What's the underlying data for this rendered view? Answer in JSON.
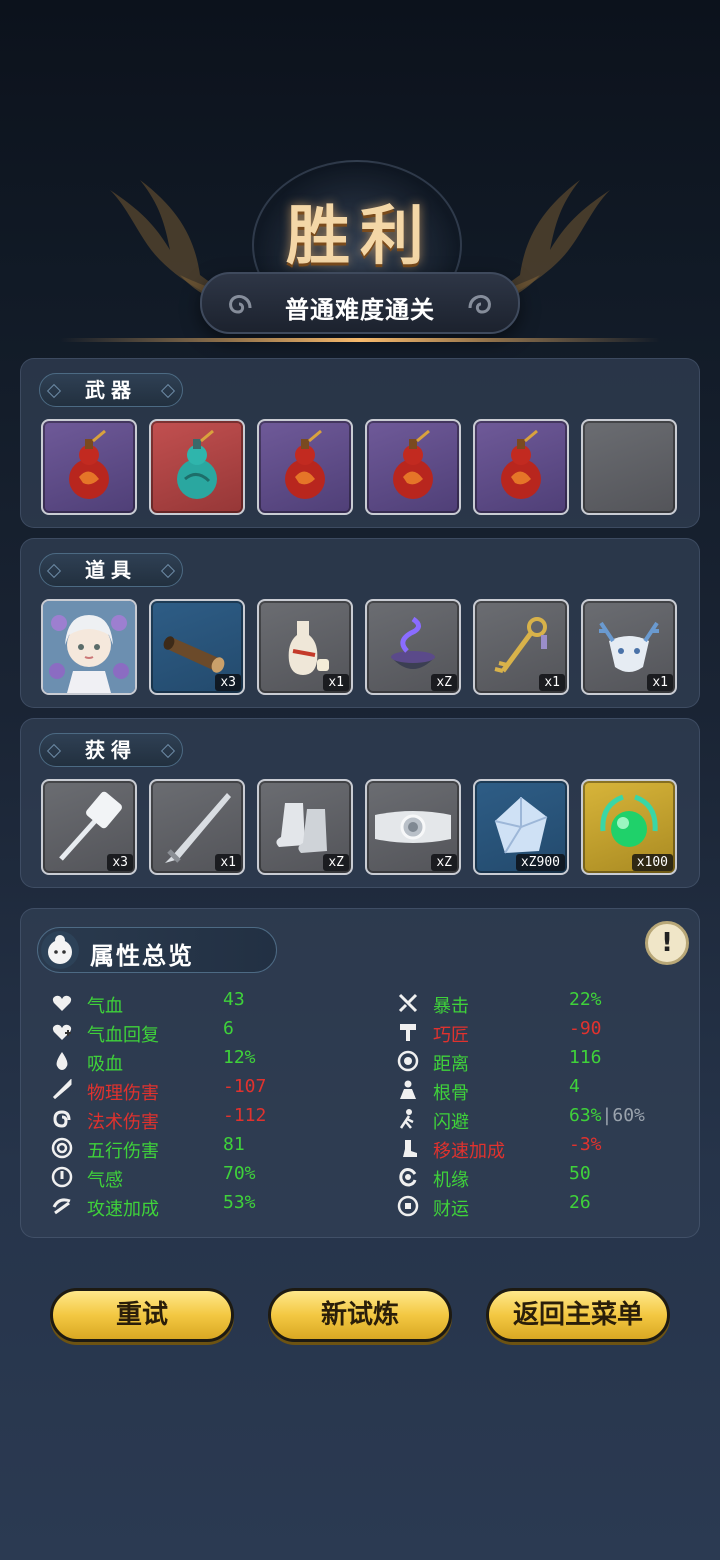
{
  "header": {
    "title": "胜利",
    "subtitle": "普通难度通关"
  },
  "weapons": {
    "label": "武器",
    "slots": [
      {
        "rarity": "purple",
        "icon": "red-gourd-icon"
      },
      {
        "rarity": "red",
        "icon": "teal-gourd-icon"
      },
      {
        "rarity": "purple",
        "icon": "red-gourd-icon"
      },
      {
        "rarity": "purple",
        "icon": "red-gourd-icon"
      },
      {
        "rarity": "purple",
        "icon": "red-gourd-icon"
      },
      {
        "rarity": "gray",
        "icon": "empty-slot"
      }
    ]
  },
  "items": {
    "label": "道具",
    "slots": [
      {
        "rarity": "purple",
        "icon": "character-portrait",
        "count": ""
      },
      {
        "rarity": "blue",
        "icon": "wood-log-icon",
        "count": "x3"
      },
      {
        "rarity": "gray",
        "icon": "wine-bottle-icon",
        "count": "x1"
      },
      {
        "rarity": "gray",
        "icon": "incense-bowl-icon",
        "count": "xZ"
      },
      {
        "rarity": "gray",
        "icon": "golden-key-icon",
        "count": "x1"
      },
      {
        "rarity": "gray",
        "icon": "deer-mask-icon",
        "count": "x1"
      }
    ]
  },
  "obtained": {
    "label": "获得",
    "slots": [
      {
        "rarity": "gray",
        "icon": "mace-icon",
        "count": "x3"
      },
      {
        "rarity": "gray",
        "icon": "sword-icon",
        "count": "x1"
      },
      {
        "rarity": "gray",
        "icon": "boots-icon",
        "count": "xZ"
      },
      {
        "rarity": "gray",
        "icon": "belt-icon",
        "count": "xZ"
      },
      {
        "rarity": "blue",
        "icon": "crystal-icon",
        "count": "xZ900"
      },
      {
        "rarity": "gold",
        "icon": "jade-orb-icon",
        "count": "x100"
      }
    ]
  },
  "attributes": {
    "title": "属性总览",
    "info_label": "!",
    "left": [
      {
        "label": "气血",
        "value": "43",
        "color": "green",
        "icon": "heart-icon"
      },
      {
        "label": "气血回复",
        "value": "6",
        "color": "green",
        "icon": "heart-regen-icon"
      },
      {
        "label": "吸血",
        "value": "12%",
        "color": "green",
        "icon": "blood-drop-icon"
      },
      {
        "label": "物理伤害",
        "value": "-107",
        "color": "red",
        "icon": "sword-damage-icon"
      },
      {
        "label": "法术伤害",
        "value": "-112",
        "color": "red",
        "icon": "spell-swirl-icon"
      },
      {
        "label": "五行伤害",
        "value": "81",
        "color": "green",
        "icon": "five-elements-icon"
      },
      {
        "label": "气感",
        "value": "70%",
        "color": "green",
        "icon": "qi-sense-icon"
      },
      {
        "label": "攻速加成",
        "value": "53%",
        "color": "green",
        "icon": "attack-speed-icon"
      }
    ],
    "right": [
      {
        "label": "暴击",
        "value": "22%",
        "color": "green",
        "icon": "crit-icon"
      },
      {
        "label": "巧匠",
        "value": "-90",
        "color": "red",
        "icon": "hammer-icon"
      },
      {
        "label": "距离",
        "value": "116",
        "color": "green",
        "icon": "range-target-icon"
      },
      {
        "label": "根骨",
        "value": "4",
        "color": "green",
        "icon": "constitution-icon"
      },
      {
        "label": "闪避",
        "value": "63%",
        "extra": "|60%",
        "color": "green",
        "icon": "dodge-icon"
      },
      {
        "label": "移速加成",
        "value": "-3%",
        "color": "red",
        "icon": "boot-speed-icon"
      },
      {
        "label": "机缘",
        "value": "50",
        "color": "green",
        "icon": "fortune-swirl-icon"
      },
      {
        "label": "财运",
        "value": "26",
        "color": "green",
        "icon": "coin-icon"
      }
    ]
  },
  "buttons": {
    "retry": "重试",
    "new_trial": "新试炼",
    "main_menu": "返回主菜单"
  },
  "colors": {
    "positive": "#3fd23a",
    "negative": "#e0322e",
    "button_gold": "#f3c842",
    "title_gold": "#f4d7a7"
  }
}
